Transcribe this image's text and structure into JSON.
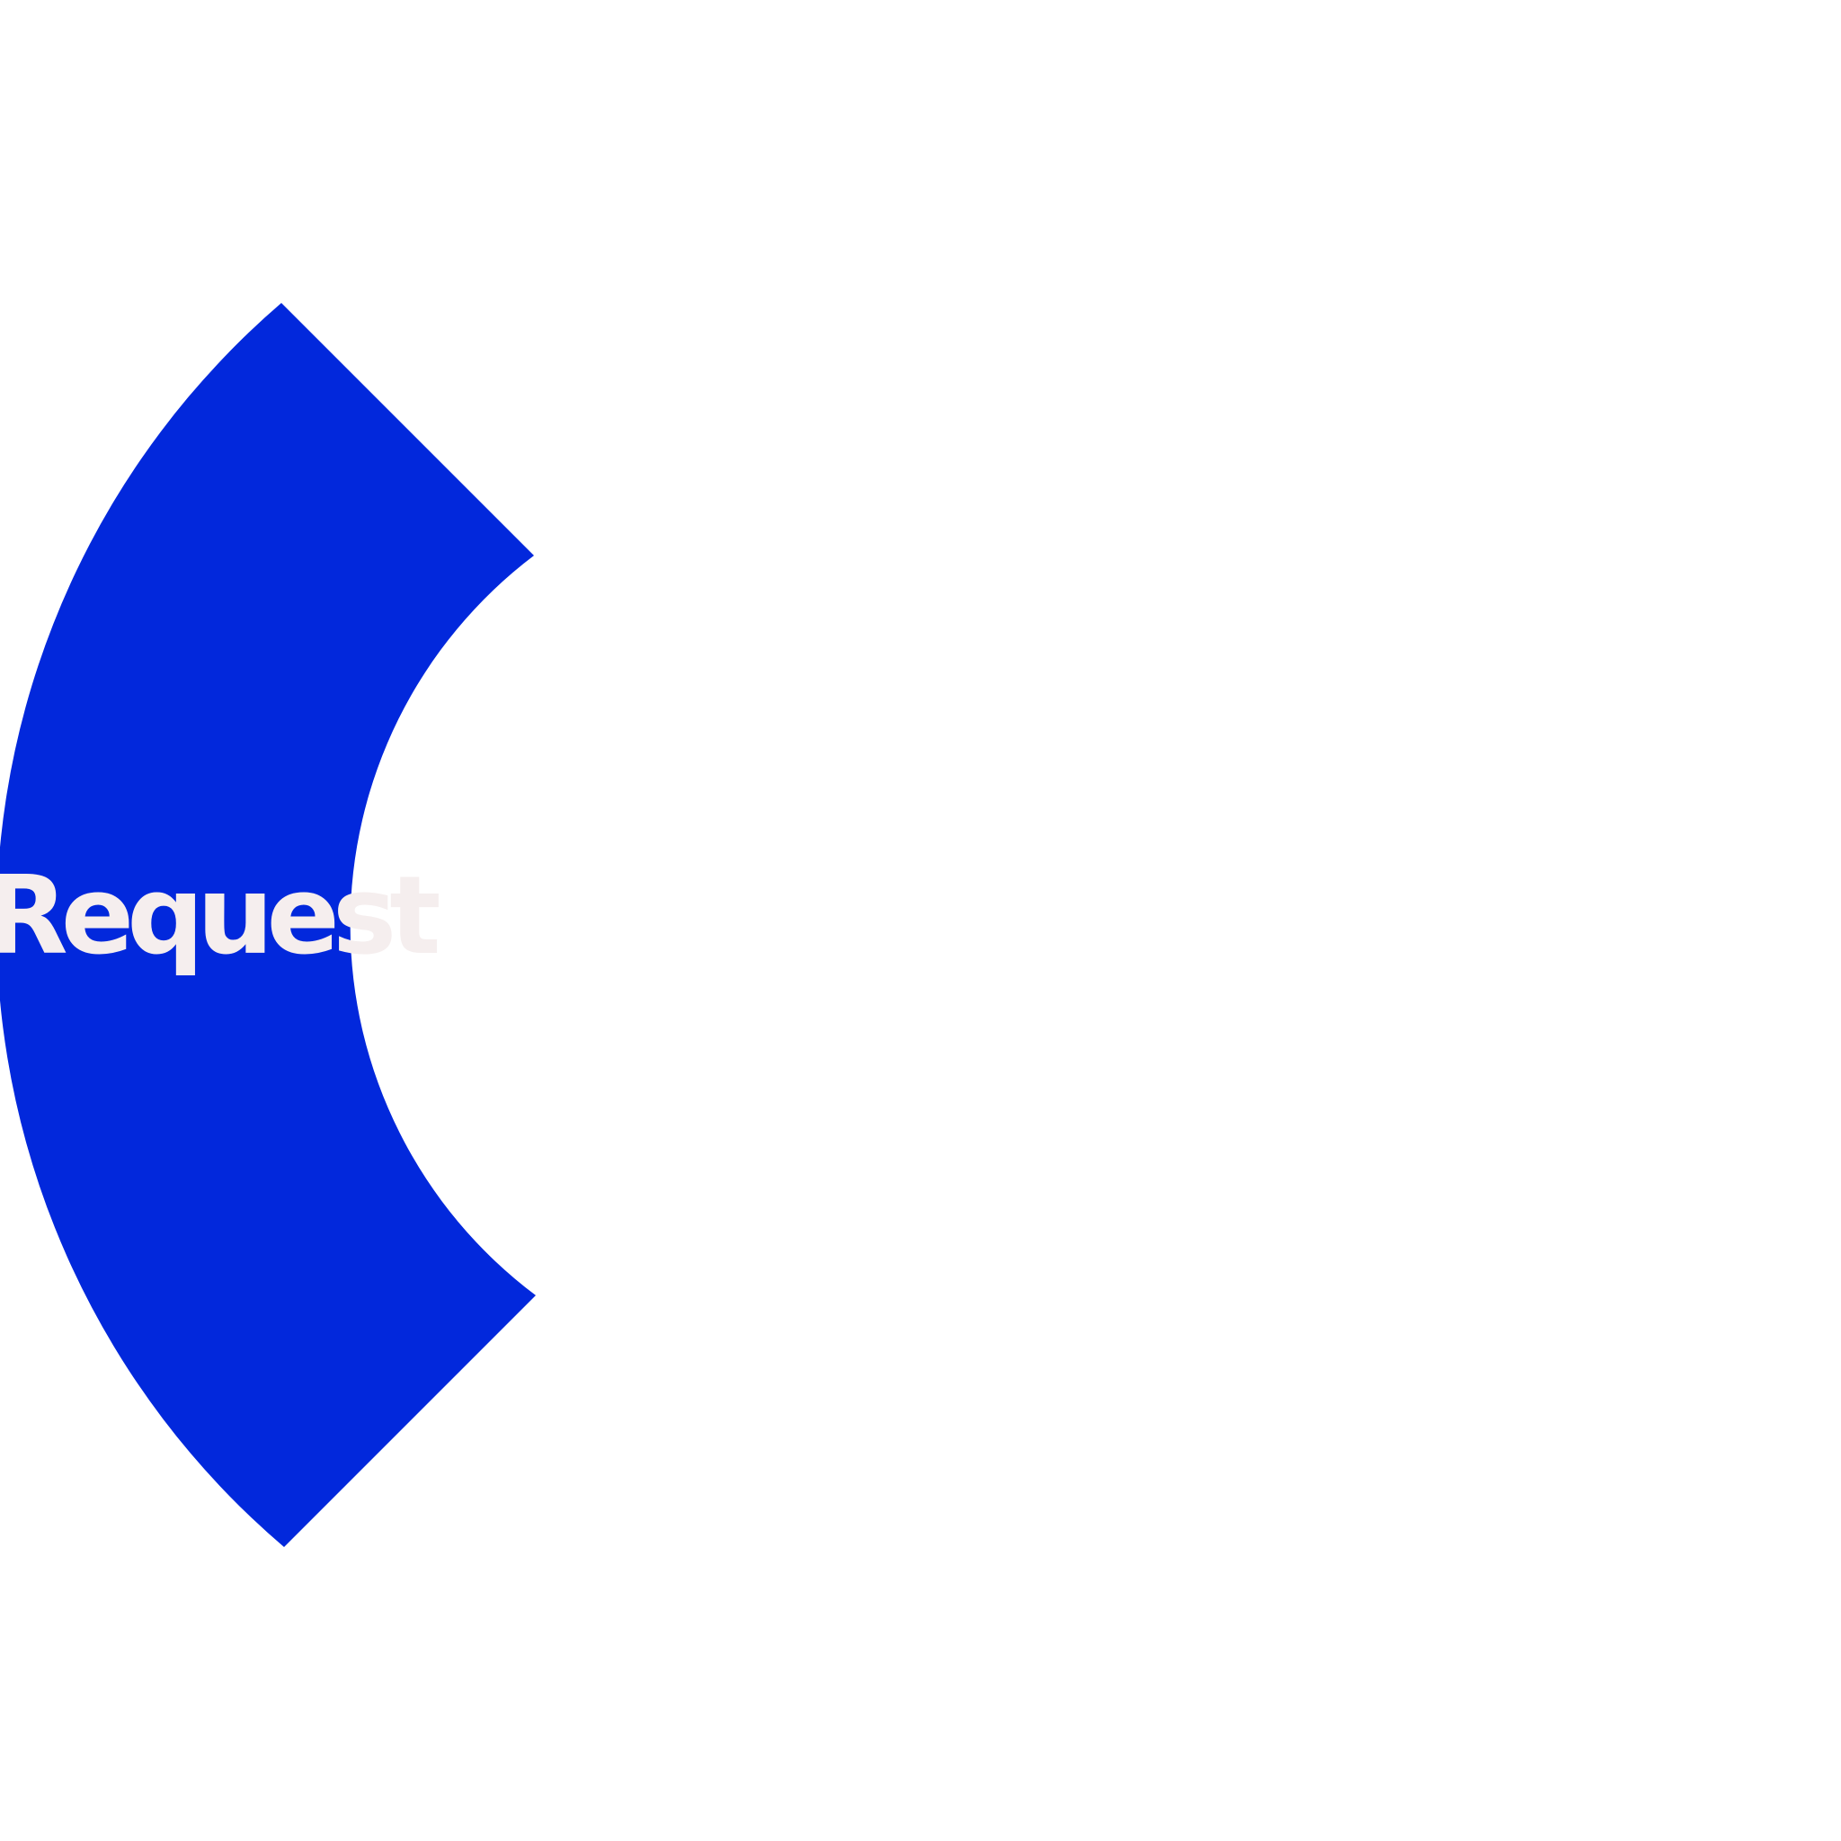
{
  "diagram": {
    "segments": [
      {
        "label": "Request",
        "fill_color": "#0228dc",
        "label_color": "#f5eeee"
      }
    ]
  }
}
